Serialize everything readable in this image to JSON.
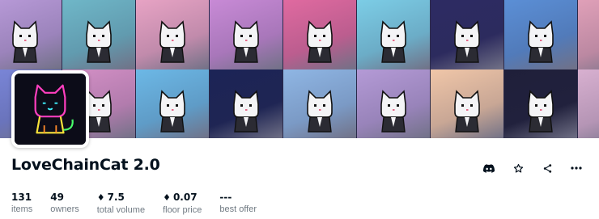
{
  "collection": {
    "name": "LoveChainCat 2.0"
  },
  "banner": {
    "row1_colors": [
      "#b89ad8",
      "#6fb7c8",
      "#e7a3c4",
      "#c88ad6",
      "#e06aa0",
      "#7ccde6",
      "#2d2b63",
      "#5b8fd6",
      "#e0a0b8"
    ],
    "row2_colors": [
      "#7a86d8",
      "#d490c6",
      "#6cb8e6",
      "#1c2456",
      "#8fb6e4",
      "#b49ad6",
      "#f0c6a8",
      "#1f1f3a",
      "#d8b0d0"
    ]
  },
  "actions": [
    {
      "name": "discord-icon",
      "label": "Discord"
    },
    {
      "name": "star-icon",
      "label": "Favorite"
    },
    {
      "name": "share-icon",
      "label": "Share"
    },
    {
      "name": "more-icon",
      "label": "More"
    }
  ],
  "stats": {
    "items": {
      "value": "131",
      "label": "items"
    },
    "owners": {
      "value": "49",
      "label": "owners"
    },
    "total_volume": {
      "value": "7.5",
      "label": "total volume",
      "currency_symbol": "♦"
    },
    "floor_price": {
      "value": "0.07",
      "label": "floor price",
      "currency_symbol": "♦"
    },
    "best_offer": {
      "value": "---",
      "label": "best offer"
    }
  }
}
